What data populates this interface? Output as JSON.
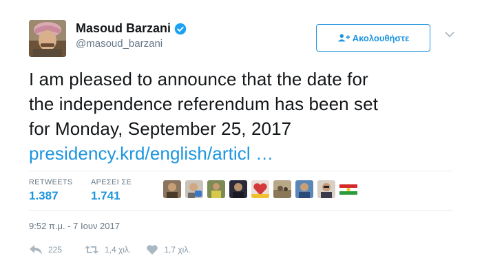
{
  "user": {
    "display_name": "Masoud Barzani",
    "handle": "@masoud_barzani",
    "verified": true
  },
  "follow_button": {
    "label": "Ακολουθήστε",
    "icon": "add-user-icon"
  },
  "tweet": {
    "lines": [
      "I am pleased to announce that the date for",
      "the independence referendum has been set",
      "for Monday, September 25, 2017"
    ],
    "link": "presidency.krd/english/articl …"
  },
  "stats": {
    "retweets_label": "RETWEETS",
    "retweets_value": "1.387",
    "likes_label": "ΑΡΕΣΕΙ ΣΕ",
    "likes_value": "1.741"
  },
  "timestamp": "9:52 π.μ. - 7 Ιουν 2017",
  "actions": {
    "reply_count": "225",
    "retweet_count": "1,4 χιλ.",
    "like_count": "1,7 χιλ."
  },
  "colors": {
    "accent": "#1b95e0",
    "text": "#14171a",
    "muted": "#657786",
    "divider": "#e6ecf0"
  }
}
